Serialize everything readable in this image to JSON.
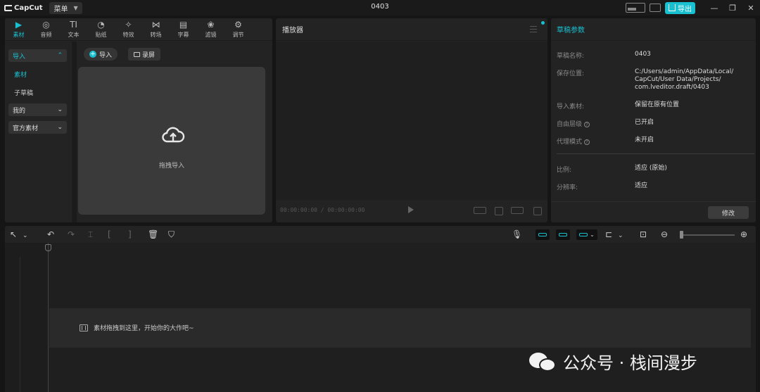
{
  "app": {
    "logo_text": "CapCut",
    "menu_label": "菜单",
    "project_title": "0403",
    "export_label": "导出",
    "window_controls": [
      "—",
      "❐",
      "✕"
    ]
  },
  "media_tabs": [
    {
      "label": "素材",
      "icon": "▶",
      "active": true
    },
    {
      "label": "音频",
      "icon": "◎"
    },
    {
      "label": "文本",
      "icon": "TI"
    },
    {
      "label": "贴纸",
      "icon": "◔"
    },
    {
      "label": "特效",
      "icon": "✧"
    },
    {
      "label": "转场",
      "icon": "⋈"
    },
    {
      "label": "字幕",
      "icon": "▤"
    },
    {
      "label": "滤镜",
      "icon": "❀"
    },
    {
      "label": "调节",
      "icon": "⚙"
    }
  ],
  "sidebar": {
    "import_section": "导入",
    "materials": "素材",
    "sub_draft": "子草稿",
    "mine": "我的",
    "official": "官方素材"
  },
  "media": {
    "import_button": "导入",
    "record_button": "录屏",
    "drop_hint": "拖拽导入"
  },
  "player": {
    "title": "播放器",
    "timecode": "00:00:00:00 / 00:00:00:00"
  },
  "draft": {
    "title": "草稿参数",
    "rows": [
      {
        "label": "草稿名称:",
        "value": "0403"
      },
      {
        "label": "保存位置:",
        "value": "C:/Users/admin/AppData/Local/\nCapCut/User Data/Projects/\ncom.lveditor.draft/0403"
      },
      {
        "label": "导入素材:",
        "value": "保留在原有位置"
      },
      {
        "label": "自由层级",
        "value": "已开启"
      },
      {
        "label": "代理模式",
        "value": "未开启"
      },
      {
        "label": "比例:",
        "value": "适应 (原始)"
      },
      {
        "label": "分辨率:",
        "value": "适应"
      }
    ],
    "modify_button": "修改"
  },
  "timeline": {
    "drop_hint": "素材拖拽到这里，开始你的大作吧~"
  },
  "watermark": {
    "text": "公众号 · 栈间漫步"
  },
  "colors": {
    "accent": "#19c0cf",
    "panel_bg": "#232323",
    "app_bg": "#151515"
  }
}
